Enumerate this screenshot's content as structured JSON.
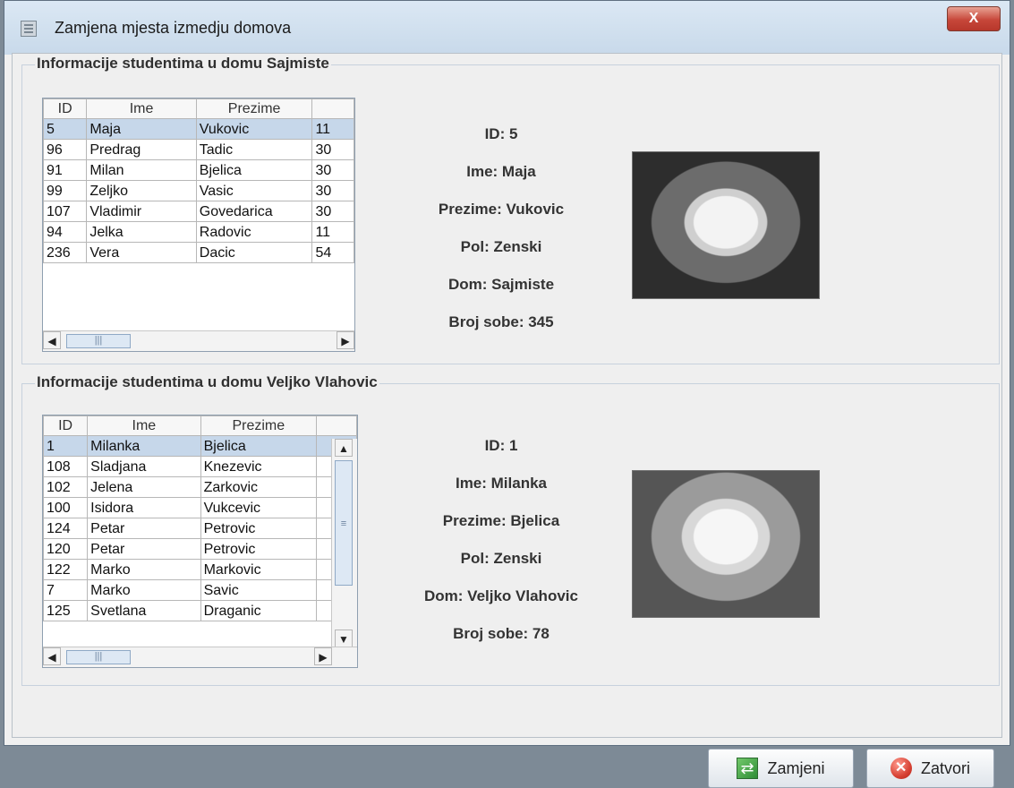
{
  "window": {
    "title": "Zamjena mjesta izmedju domova",
    "close_label": "X"
  },
  "top_panel": {
    "title": "Informacije studentima u domu Sajmiste",
    "headers": [
      "ID",
      "Ime",
      "Prezime",
      ""
    ],
    "rows": [
      [
        "5",
        "Maja",
        "Vukovic",
        "11"
      ],
      [
        "96",
        "Predrag",
        "Tadic",
        "30"
      ],
      [
        "91",
        "Milan",
        "Bjelica",
        "30"
      ],
      [
        "99",
        "Zeljko",
        "Vasic",
        "30"
      ],
      [
        "107",
        "Vladimir",
        "Govedarica",
        "30"
      ],
      [
        "94",
        "Jelka",
        "Radovic",
        "11"
      ],
      [
        "236",
        "Vera",
        "Dacic",
        "54"
      ]
    ],
    "details": {
      "id": "ID: 5",
      "ime": "Ime: Maja",
      "prezime": "Prezime: Vukovic",
      "pol": "Pol: Zenski",
      "dom": "Dom: Sajmiste",
      "soba": "Broj sobe: 345"
    }
  },
  "bottom_panel": {
    "title": "Informacije studentima u domu Veljko Vlahovic",
    "headers": [
      "ID",
      "Ime",
      "Prezime",
      ""
    ],
    "rows": [
      [
        "1",
        "Milanka",
        "Bjelica",
        ""
      ],
      [
        "108",
        "Sladjana",
        "Knezevic",
        ""
      ],
      [
        "102",
        "Jelena",
        "Zarkovic",
        ""
      ],
      [
        "100",
        "Isidora",
        "Vukcevic",
        ""
      ],
      [
        "124",
        "Petar",
        "Petrovic",
        ""
      ],
      [
        "120",
        "Petar",
        "Petrovic",
        ""
      ],
      [
        "122",
        "Marko",
        "Markovic",
        ""
      ],
      [
        "7",
        "Marko",
        "Savic",
        ""
      ],
      [
        "125",
        "Svetlana",
        "Draganic",
        ""
      ]
    ],
    "details": {
      "id": "ID: 1",
      "ime": "Ime: Milanka",
      "prezime": "Prezime: Bjelica",
      "pol": "Pol: Zenski",
      "dom": "Dom: Veljko Vlahovic",
      "soba": "Broj sobe: 78"
    }
  },
  "buttons": {
    "zamjeni": "Zamjeni",
    "zatvori": "Zatvori"
  },
  "icons": {
    "window": "window-icon",
    "zamjeni": "swap-icon",
    "zatvori": "close-circle-icon"
  }
}
